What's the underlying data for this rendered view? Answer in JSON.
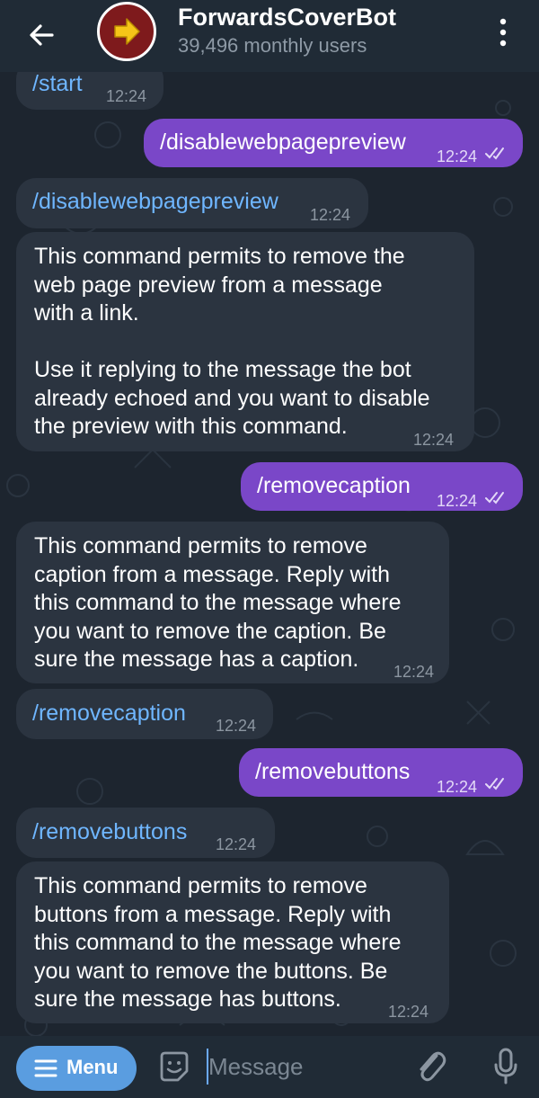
{
  "header": {
    "title": "ForwardsCoverBot",
    "subtitle": "39,496 monthly users"
  },
  "messages": [
    {
      "text": "/start",
      "time": "12:24"
    },
    {
      "text": "/disablewebpagepreview",
      "time": "12:24"
    },
    {
      "text": "/disablewebpagepreview",
      "time": "12:24"
    },
    {
      "lines": [
        "This command permits to remove the",
        "web page preview from a message",
        "with a link.",
        "",
        "Use it replying to the message the bot",
        "already echoed and you want to disable",
        "the preview with this command."
      ],
      "time": "12:24"
    },
    {
      "text": "/removecaption",
      "time": "12:24"
    },
    {
      "lines": [
        "This command permits to remove",
        "caption from a message. Reply with",
        "this command to the message where",
        "you want to remove the caption. Be",
        "sure the message has a caption."
      ],
      "time": "12:24"
    },
    {
      "text": "/removecaption",
      "time": "12:24"
    },
    {
      "text": "/removebuttons",
      "time": "12:24"
    },
    {
      "text": "/removebuttons",
      "time": "12:24"
    },
    {
      "lines": [
        "This command permits to remove",
        "buttons from a message. Reply with",
        "this command to the message where",
        "you want to remove the buttons. Be",
        "sure the message has buttons."
      ],
      "time": "12:24"
    }
  ],
  "input_bar": {
    "menu_label": "Menu",
    "placeholder": "Message"
  },
  "colors": {
    "outgoing_bubble": "#7a47c8",
    "incoming_bubble": "#2b3440",
    "link": "#6fb6ff",
    "menu_button": "#5a9de0"
  },
  "icons": [
    "back-arrow-icon",
    "forward-arrow-avatar-icon",
    "more-vertical-icon",
    "double-check-icon",
    "sticker-icon",
    "attach-icon",
    "microphone-icon"
  ]
}
